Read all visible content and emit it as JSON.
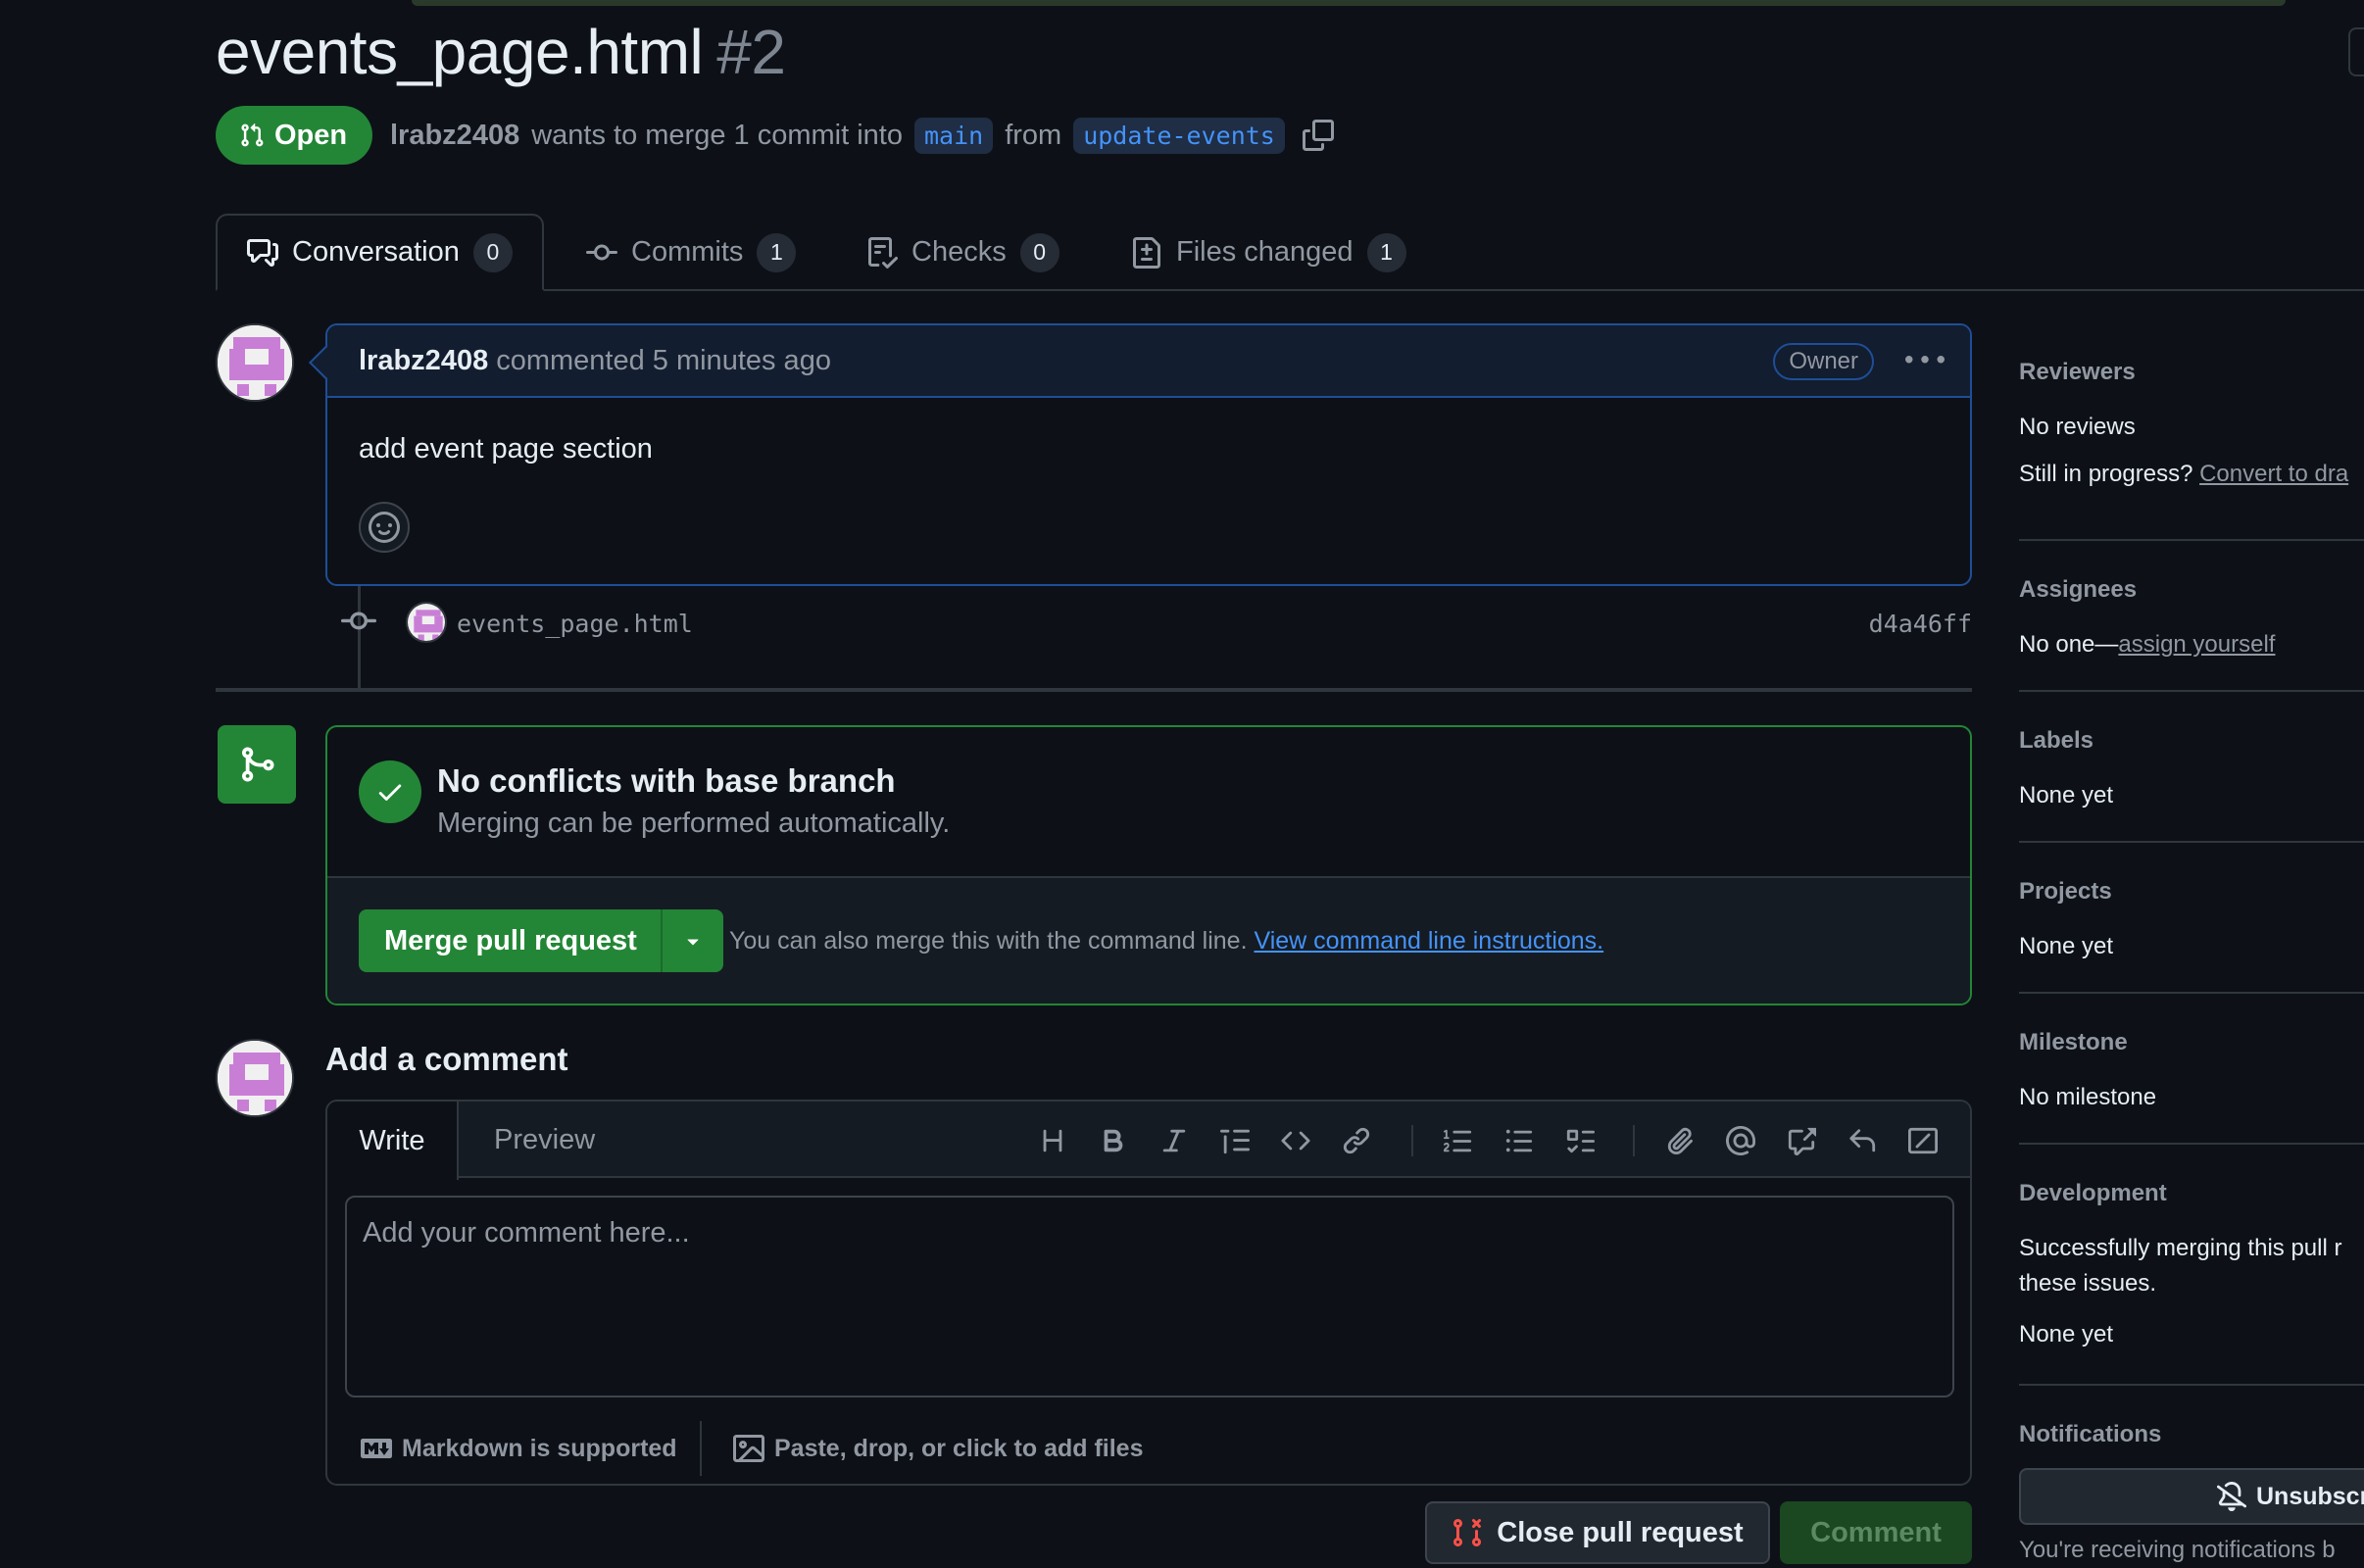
{
  "pr": {
    "title": "events_page.html",
    "number": "#2",
    "state": "Open",
    "author": "lrabz2408",
    "merge_text": "wants to merge 1 commit into",
    "base_branch": "main",
    "from_text": "from",
    "head_branch": "update-events"
  },
  "tabs": [
    {
      "label": "Conversation",
      "count": "0"
    },
    {
      "label": "Commits",
      "count": "1"
    },
    {
      "label": "Checks",
      "count": "0"
    },
    {
      "label": "Files changed",
      "count": "1"
    }
  ],
  "comment": {
    "author": "lrabz2408",
    "action": "commented 5 minutes ago",
    "badge": "Owner",
    "body": "add event page section"
  },
  "commit": {
    "name": "events_page.html",
    "sha": "d4a46ff"
  },
  "merge": {
    "title": "No conflicts with base branch",
    "subtitle": "Merging can be performed automatically.",
    "button": "Merge pull request",
    "hint": "You can also merge this with the command line.",
    "hint_link": "View command line instructions."
  },
  "add_comment": {
    "title": "Add a comment",
    "tab_write": "Write",
    "tab_preview": "Preview",
    "placeholder": "Add your comment here...",
    "markdown": "Markdown is supported",
    "files": "Paste, drop, or click to add files",
    "close_button": "Close pull request",
    "comment_button": "Comment"
  },
  "sidebar": {
    "reviewers": {
      "heading": "Reviewers",
      "text": "No reviews",
      "progress": "Still in progress?",
      "progress_link": "Convert to dra"
    },
    "assignees": {
      "heading": "Assignees",
      "text": "No one—",
      "link": "assign yourself"
    },
    "labels": {
      "heading": "Labels",
      "text": "None yet"
    },
    "projects": {
      "heading": "Projects",
      "text": "None yet"
    },
    "milestone": {
      "heading": "Milestone",
      "text": "No milestone"
    },
    "development": {
      "heading": "Development",
      "line1": "Successfully merging this pull r",
      "line2": "these issues.",
      "text": "None yet"
    },
    "notifications": {
      "heading": "Notifications",
      "button": "Unsubscr",
      "footer": "You're receiving notifications b"
    }
  },
  "colors": {
    "background": "#0d1117",
    "open_green": "#238636",
    "link_blue": "#4493f8",
    "border": "#30363d",
    "comment_border": "#1f4e97"
  },
  "icons": [
    "git-pull-request-icon",
    "copy-icon",
    "comment-discussion-icon",
    "git-commit-icon",
    "checklist-icon",
    "file-diff-icon",
    "kebab-horizontal-icon",
    "smiley-icon",
    "git-merge-icon",
    "check-icon",
    "triangle-down-icon",
    "markdown-icon",
    "image-icon",
    "bell-slash-icon",
    "git-pull-request-closed-icon"
  ]
}
